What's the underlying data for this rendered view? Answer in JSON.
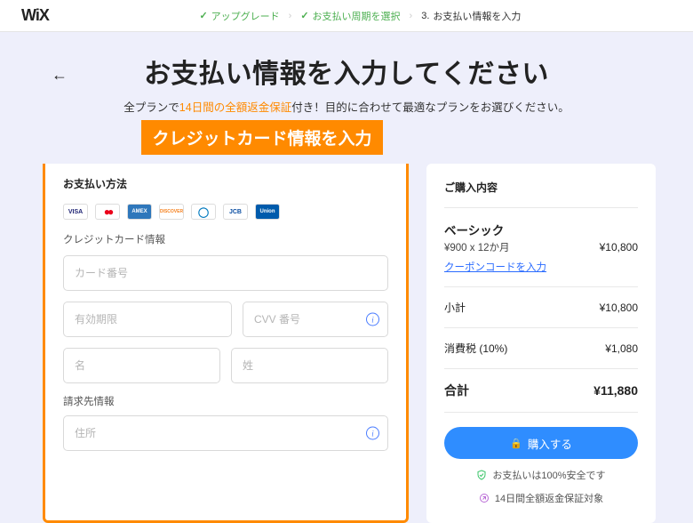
{
  "logo": "WiX",
  "steps": {
    "s1": "アップグレード",
    "s2": "お支払い周期を選択",
    "s3_num": "3.",
    "s3": "お支払い情報を入力"
  },
  "back_arrow": "←",
  "title": "お支払い情報を入力してください",
  "subtitle_pre": "全プランで",
  "subtitle_hl": "14日間の全額返金保証",
  "subtitle_post": "付き！目的に合わせて最適なプランをお選びください。",
  "callout": "クレジットカード情報を入力",
  "left": {
    "header": "お支払い方法",
    "cards": {
      "visa": "VISA",
      "mc": "●●",
      "amex": "AMEX",
      "discover": "DISCOVER",
      "diners": "◯",
      "jcb": "JCB",
      "union": "Union"
    },
    "sub1": "クレジットカード情報",
    "ph_cardnum": "カード番号",
    "ph_exp": "有効期限",
    "ph_cvv": "CVV 番号",
    "ph_first": "名",
    "ph_last": "姓",
    "sub2": "請求先情報",
    "ph_addr": "住所"
  },
  "right": {
    "header": "ご購入内容",
    "plan_name": "ベーシック",
    "plan_sub": "¥900 x 12か月",
    "plan_price": "¥10,800",
    "coupon": "クーポンコードを入力",
    "subtotal_label": "小計",
    "subtotal_val": "¥10,800",
    "tax_label": "消費税 (10%)",
    "tax_val": "¥1,080",
    "total_label": "合計",
    "total_val": "¥11,880",
    "buy": "購入する",
    "assure1": "お支払いは100%安全です",
    "assure2": "14日間全額返金保証対象"
  }
}
